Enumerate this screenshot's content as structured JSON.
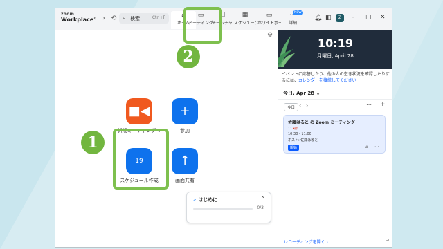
{
  "app": {
    "brand_small": "zoom",
    "brand_large": "Workplace"
  },
  "nav": {
    "back": "‹",
    "forward": "›",
    "history": "⟲"
  },
  "search": {
    "placeholder": "検索",
    "shortcut": "Ctrl+F",
    "icon": "search-icon"
  },
  "tabs": [
    {
      "label": "ホーム",
      "icon": "home-icon"
    },
    {
      "label": "ミーティング",
      "icon": "video-icon"
    },
    {
      "label": "チームチャット",
      "icon": "chat-icon"
    },
    {
      "label": "スケジューラー",
      "icon": "calendar-icon"
    },
    {
      "label": "ホワイトボード",
      "icon": "whiteboard-icon"
    },
    {
      "label": "詳細",
      "icon": "more-icon",
      "badge": "NEW"
    }
  ],
  "window_controls": {
    "minimize": "–",
    "maximize": "□",
    "close": "✕"
  },
  "avatar_text": "Z",
  "main": {
    "actions": [
      {
        "label": "新規ミーティング",
        "icon": "video-camera-icon",
        "color": "#f0591f",
        "has_chevron": true
      },
      {
        "label": "参加",
        "icon": "plus-icon",
        "color": "#0e72ed"
      },
      {
        "label": "スケジュール作成",
        "icon": "calendar-icon",
        "color": "#0e72ed",
        "day": "19"
      },
      {
        "label": "画面共有",
        "icon": "share-up-icon",
        "color": "#0e72ed"
      }
    ],
    "getting_started": {
      "title": "はじめに",
      "progress_text": "0/3",
      "progress": 0
    }
  },
  "calendar": {
    "time": "10:19",
    "date": "月曜日, April 28",
    "info_text": "イベントに応答したり、他の人の空き状況を確認したりするには、",
    "info_link": "カレンダーを接続してください",
    "date_header": "今日, Apr 28 ⌄",
    "today_button": "今日",
    "meeting": {
      "title": "佐藤はると の Zoom ミーティング",
      "day": "11",
      "day_mark": "⏺録",
      "time": "10:30 - 11:00",
      "host": "ホスト: 佐藤はると",
      "start_button": "開始"
    },
    "open_link": "レコーディングを開く ›"
  },
  "annotations": {
    "step1": "1",
    "step2": "2",
    "highlight_color": "#7ec04e"
  }
}
